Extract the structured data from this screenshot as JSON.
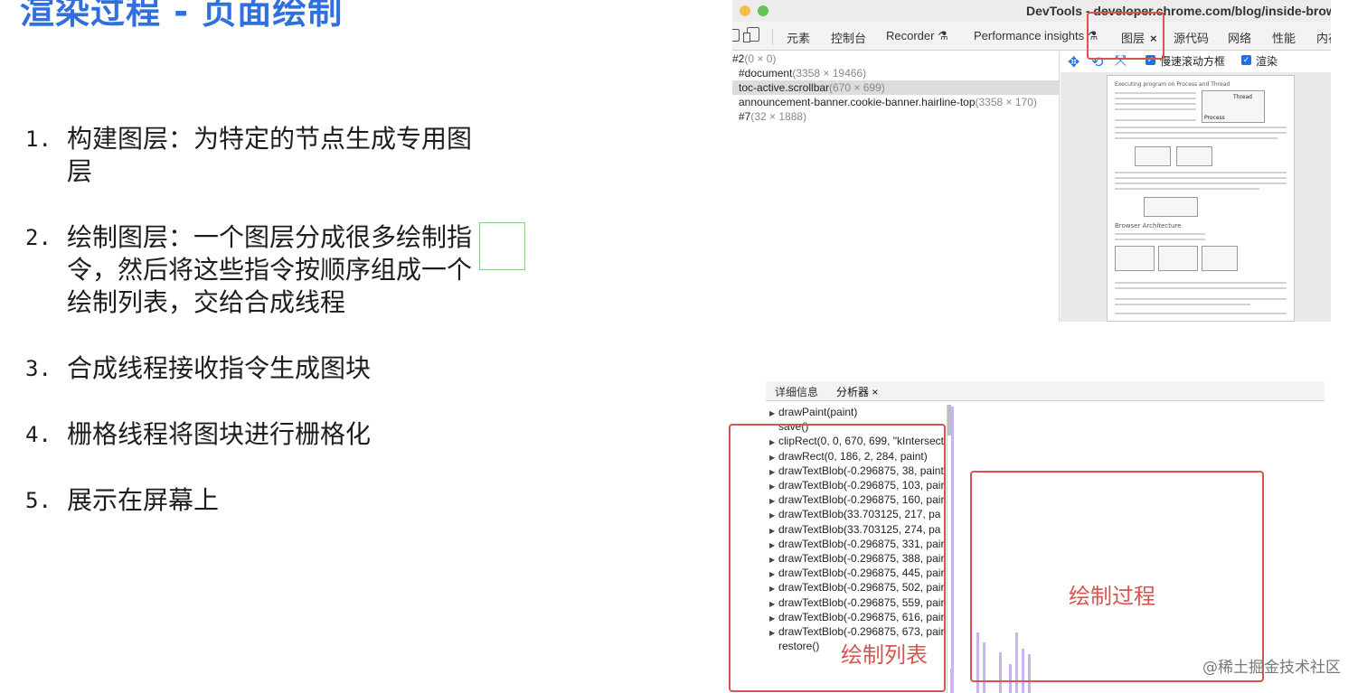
{
  "slide": {
    "title": "渲染过程 - 页面绘制",
    "steps": [
      {
        "num": "1.",
        "line1": "构建图层：为特定的节点生成专用图",
        "line2": "层"
      },
      {
        "num": "2.",
        "line1": "绘制图层：一个图层分成很多绘制指",
        "line2": "令，然后将这些指令按顺序组成一个",
        "line3": "绘制列表，交给合成线程"
      },
      {
        "num": "3.",
        "line1": "合成线程接收指令生成图块"
      },
      {
        "num": "4.",
        "line1": "栅格线程将图块进行栅格化"
      },
      {
        "num": "5.",
        "line1": "展示在屏幕上"
      }
    ]
  },
  "devtools": {
    "window_title": "DevTools - developer.chrome.com/blog/inside-brow",
    "tabs": {
      "elements": "元素",
      "console": "控制台",
      "recorder": "Recorder",
      "recorder_icon": "flask-icon",
      "perf_insights": "Performance insights",
      "perf_icon": "flask-icon",
      "layers": "图层",
      "layers_close": "×",
      "sources": "源代码",
      "network": "网络",
      "performance": "性能",
      "memory": "内存"
    },
    "layer_tree": {
      "root": {
        "name": "#2",
        "dims": "(0 × 0)"
      },
      "rows": [
        {
          "name": "#document",
          "dims": "(3358 × 19466)"
        },
        {
          "name": "toc-active.scrollbar",
          "dims": "(670 × 699)"
        },
        {
          "name": "announcement-banner.cookie-banner.hairline-top",
          "dims": "(3358 × 170)"
        },
        {
          "name": "#7",
          "dims": "(32 × 1888)"
        }
      ]
    },
    "toolbar": {
      "slow_scroll_label": "慢速滚动方框",
      "paint_label": "渲染",
      "checked": true
    },
    "preview": {
      "heading1": "Executing program on Process and Thread",
      "heading2": "Browser Architecture",
      "fig_label_thread": "Thread",
      "fig_label_process": "Process"
    }
  },
  "profiler": {
    "tab_details": "详细信息",
    "tab_profiler": "分析器",
    "tab_close": "×",
    "commands": [
      {
        "expand": true,
        "text": "drawPaint(paint)"
      },
      {
        "expand": false,
        "text": "save()"
      },
      {
        "expand": true,
        "text": "clipRect(0, 0, 670, 699, \"kIntersect"
      },
      {
        "expand": true,
        "text": "drawRect(0, 186, 2, 284, paint)"
      },
      {
        "expand": true,
        "text": "drawTextBlob(-0.296875, 38, paint"
      },
      {
        "expand": true,
        "text": "drawTextBlob(-0.296875, 103, pair"
      },
      {
        "expand": true,
        "text": "drawTextBlob(-0.296875, 160, pair"
      },
      {
        "expand": true,
        "text": "drawTextBlob(33.703125, 217, pa"
      },
      {
        "expand": true,
        "text": "drawTextBlob(33.703125, 274, pa"
      },
      {
        "expand": true,
        "text": "drawTextBlob(-0.296875, 331, pair"
      },
      {
        "expand": true,
        "text": "drawTextBlob(-0.296875, 388, pair"
      },
      {
        "expand": true,
        "text": "drawTextBlob(-0.296875, 445, pair"
      },
      {
        "expand": true,
        "text": "drawTextBlob(-0.296875, 502, pair"
      },
      {
        "expand": true,
        "text": "drawTextBlob(-0.296875, 559, pair"
      },
      {
        "expand": true,
        "text": "drawTextBlob(-0.296875, 616, pair"
      },
      {
        "expand": true,
        "text": "drawTextBlob(-0.296875, 673, pair"
      },
      {
        "expand": false,
        "text": "restore()"
      }
    ]
  },
  "annotations": {
    "paint_list": "绘制列表",
    "paint_process": "绘制过程"
  },
  "watermark": "@稀土掘金技术社区",
  "colors": {
    "title_blue": "#2f6fde",
    "annotation_red": "#d9534f",
    "devtools_blue": "#1a73e8",
    "timeline_purple": "#c8b4ef"
  }
}
